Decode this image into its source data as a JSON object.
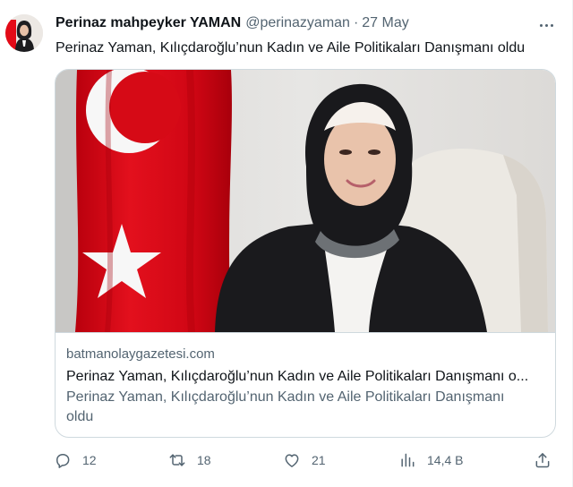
{
  "tweet": {
    "display_name": "Perinaz mahpeyker YAMAN",
    "handle": "@perinazyaman",
    "separator": "·",
    "date": "27 May",
    "text": "Perinaz Yaman, Kılıçdaroğlu’nun Kadın ve Aile Politikaları Danışmanı oldu"
  },
  "card": {
    "domain": "batmanolaygazetesi.com",
    "title": "Perinaz Yaman, Kılıçdaroğlu’nun Kadın ve Aile Politikaları Danışmanı o...",
    "description": "Perinaz Yaman, Kılıçdaroğlu’nun Kadın ve Aile Politikaları Danışmanı oldu"
  },
  "actions": {
    "replies": "12",
    "retweets": "18",
    "likes": "21",
    "views": "14,4 B"
  },
  "icons": {
    "more": "more-icon",
    "reply": "reply-icon",
    "retweet": "retweet-icon",
    "like": "heart-icon",
    "views": "views-icon",
    "share": "share-icon"
  },
  "colors": {
    "text_primary": "#0f1419",
    "text_secondary": "#536471",
    "border": "#cfd9de",
    "flag_red": "#e30a17"
  }
}
